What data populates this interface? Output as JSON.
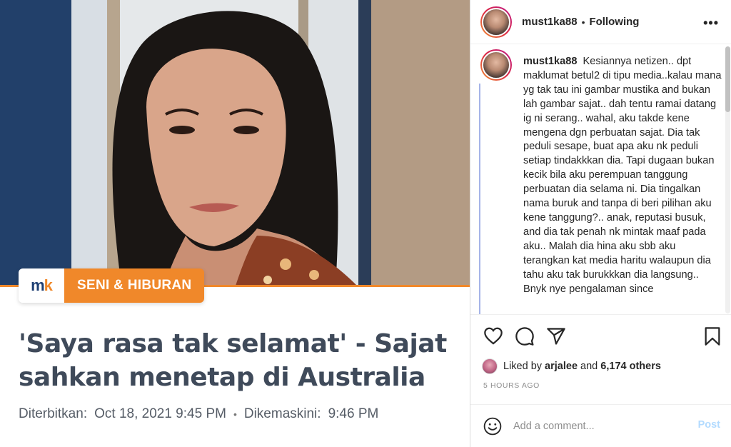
{
  "article": {
    "logo_m": "m",
    "logo_k": "k",
    "category": "SENI & HIBURAN",
    "headline": "'Saya rasa tak selamat' - Sajat sahkan menetap di Australia",
    "published_label": "Diterbitkan:",
    "published_value": "Oct 18, 2021 9:45 PM",
    "updated_label": "Dikemaskini:",
    "updated_value": "9:46 PM",
    "separator": "•",
    "accent_color": "#f0882a",
    "brand_color": "#1e3f73"
  },
  "instagram": {
    "header": {
      "username": "must1ka88",
      "separator": "•",
      "follow_status": "Following",
      "more_icon": "more-horizontal-icon"
    },
    "caption": {
      "username": "must1ka88",
      "text": "Kesiannya netizen.. dpt maklumat betul2 di tipu media..kalau mana yg tak tau ini gambar mustika and bukan lah gambar sajat.. dah tentu ramai datang ig ni serang.. wahal, aku takde kene mengena dgn perbuatan sajat. Dia tak peduli sesape, buat apa aku nk peduli setiap tindakkkan dia. Tapi dugaan bukan kecik bila aku perempuan tanggung perbuatan dia selama ni. Dia tingalkan nama buruk and tanpa di beri pilihan aku kene tanggung?.. anak, reputasi busuk, and dia tak penah nk mintak maaf pada aku.. Malah dia hina aku sbb aku terangkan kat media haritu walaupun dia tahu aku tak burukkkan dia langsung.. Bnyk nye pengalaman since"
    },
    "actions": [
      "heart-icon",
      "comment-icon",
      "share-icon",
      "bookmark-icon"
    ],
    "likes": {
      "prefix": "Liked by",
      "user": "arjalee",
      "and": "and",
      "others": "6,174 others"
    },
    "timestamp": "5 HOURS AGO",
    "comment": {
      "placeholder": "Add a comment...",
      "post_label": "Post",
      "emoji_icon": "emoji-icon"
    }
  }
}
